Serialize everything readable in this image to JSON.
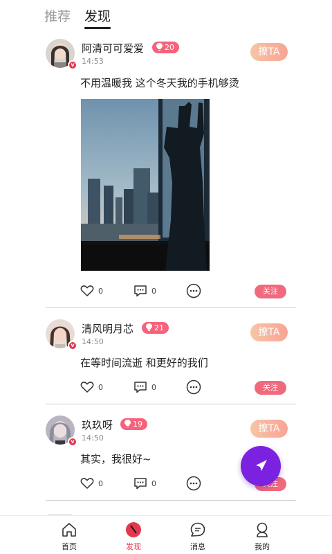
{
  "top_tabs": {
    "recommend": "推荐",
    "discover": "发现"
  },
  "colors": {
    "accent": "#e2384f",
    "level_badge": "#f7627b",
    "follow": "#f06a7e",
    "fab": "#7b22e0"
  },
  "posts": [
    {
      "name": "阿清可可爱爱",
      "level": "20",
      "time": "14:53",
      "tease": "撩TA",
      "content": "不用温暖我  这个冬天我的手机够烫",
      "likes": "0",
      "comments": "0",
      "follow": "关注",
      "has_photo": true
    },
    {
      "name": "清风明月芯",
      "level": "21",
      "time": "14:50",
      "tease": "撩TA",
      "content": "在等时间流逝   和更好的我们",
      "likes": "0",
      "comments": "0",
      "follow": "关注"
    },
    {
      "name": "玖玖呀",
      "level": "19",
      "time": "14:50",
      "tease": "撩TA",
      "content": "其实，我很好~",
      "likes": "0",
      "comments": "0",
      "follow": "关注"
    }
  ],
  "bottom_nav": [
    {
      "label": "首页",
      "icon": "home-icon"
    },
    {
      "label": "发现",
      "icon": "discover-icon",
      "active": true
    },
    {
      "label": "消息",
      "icon": "message-icon"
    },
    {
      "label": "我的",
      "icon": "profile-icon"
    }
  ],
  "fab_icon": "send-icon"
}
